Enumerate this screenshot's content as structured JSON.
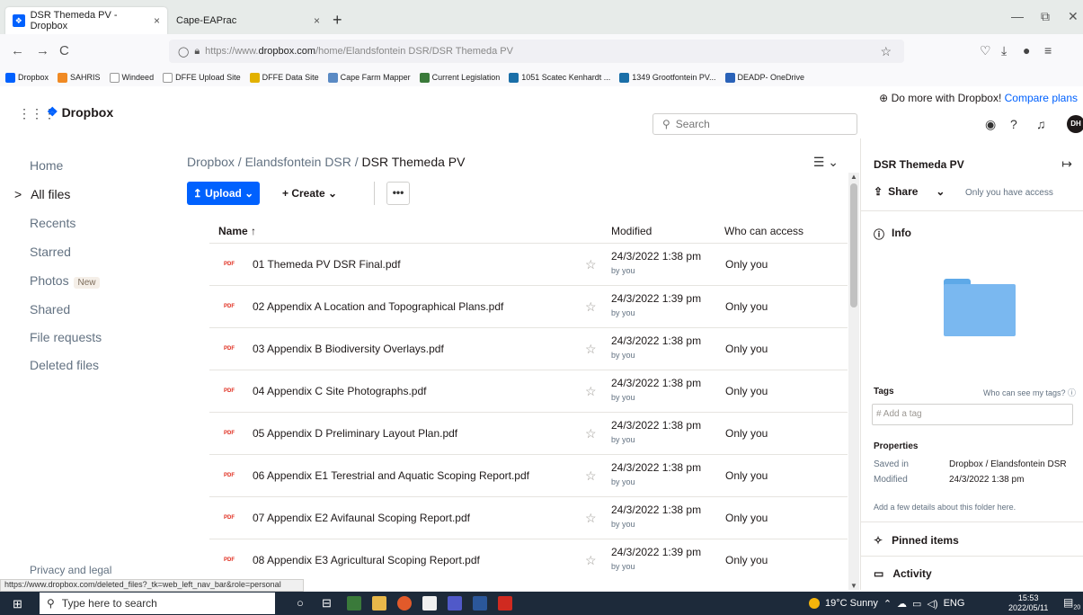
{
  "browser": {
    "tabs": [
      {
        "label": "DSR Themeda PV - Dropbox",
        "close": "×"
      },
      {
        "label": "Cape-EAPrac",
        "close": "×"
      }
    ],
    "new_tab": "+",
    "window_controls": [
      "—",
      "⧉",
      "✕"
    ],
    "nav": {
      "back": "←",
      "forward": "→",
      "reload": "C"
    },
    "url_prefix": "https://www.",
    "url_host": "dropbox.com",
    "url_path": "/home/Elandsfontein DSR/DSR Themeda PV",
    "bookmark_star": "☆",
    "right_icons": [
      "♡",
      "⤓",
      "●",
      "≡"
    ],
    "bookmarks": [
      {
        "label": "Dropbox",
        "color": "#0061fe"
      },
      {
        "label": "SAHRIS",
        "color": "#f08a24"
      },
      {
        "label": "Windeed",
        "color": "#ffffff"
      },
      {
        "label": "DFFE Upload Site",
        "color": "#ffffff"
      },
      {
        "label": "DFFE Data Site",
        "color": "#e2b100"
      },
      {
        "label": "Cape Farm Mapper",
        "color": "#5a8ac4"
      },
      {
        "label": "Current Legislation",
        "color": "#3a7a3a"
      },
      {
        "label": "1051 Scatec Kenhardt ...",
        "color": "#1a6fa8"
      },
      {
        "label": "1349 Grootfontein PV...",
        "color": "#1a6fa8"
      },
      {
        "label": "DEADP- OneDrive",
        "color": "#2a62b8"
      }
    ]
  },
  "header": {
    "grid_icon": "⋮⋮⋮",
    "logo_text": "Dropbox",
    "promo_text": "Do more with Dropbox!",
    "promo_link": "Compare plans",
    "search_placeholder": "Search",
    "avatar": "DH"
  },
  "sidebar": {
    "items": [
      {
        "label": "Home"
      },
      {
        "label": "All files",
        "arrow": ">"
      },
      {
        "label": "Recents"
      },
      {
        "label": "Starred"
      },
      {
        "label": "Photos",
        "badge": "New"
      },
      {
        "label": "Shared"
      },
      {
        "label": "File requests"
      },
      {
        "label": "Deleted files"
      }
    ],
    "privacy": "Privacy and legal"
  },
  "main": {
    "breadcrumb": {
      "path": "Dropbox / Elandsfontein DSR / ",
      "current": "DSR Themeda PV"
    },
    "view_icon": "☰ ⌄",
    "upload_label": "↥ Upload ⌄",
    "create_label": "+ Create ⌄",
    "more_label": "•••",
    "columns": {
      "name": "Name ↑",
      "modified": "Modified",
      "access": "Who can access"
    },
    "files": [
      {
        "icon": "PDF",
        "name": "01 Themeda PV DSR Final.pdf",
        "modified": "24/3/2022 1:38 pm",
        "by": "by you",
        "access": "Only you"
      },
      {
        "icon": "PDF",
        "name": "02 Appendix A Location and Topographical Plans.pdf",
        "modified": "24/3/2022 1:39 pm",
        "by": "by you",
        "access": "Only you"
      },
      {
        "icon": "PDF",
        "name": "03 Appendix B Biodiversity Overlays.pdf",
        "modified": "24/3/2022 1:38 pm",
        "by": "by you",
        "access": "Only you"
      },
      {
        "icon": "PDF",
        "name": "04 Appendix C Site Photographs.pdf",
        "modified": "24/3/2022 1:38 pm",
        "by": "by you",
        "access": "Only you"
      },
      {
        "icon": "PDF",
        "name": "05 Appendix D Preliminary Layout Plan.pdf",
        "modified": "24/3/2022 1:38 pm",
        "by": "by you",
        "access": "Only you"
      },
      {
        "icon": "PDF",
        "name": "06 Appendix E1 Terestrial and Aquatic Scoping Report.pdf",
        "modified": "24/3/2022 1:38 pm",
        "by": "by you",
        "access": "Only you"
      },
      {
        "icon": "PDF",
        "name": "07 Appendix E2 Avifaunal Scoping Report.pdf",
        "modified": "24/3/2022 1:38 pm",
        "by": "by you",
        "access": "Only you"
      },
      {
        "icon": "PDF",
        "name": "08 Appendix E3 Agricultural Scoping Report.pdf",
        "modified": "24/3/2022 1:39 pm",
        "by": "by you",
        "access": "Only you"
      }
    ]
  },
  "panel": {
    "title": "DSR Themeda PV",
    "collapse": "↦",
    "share": "Share",
    "access_text": "Only you have access",
    "info": "Info",
    "tags": "Tags",
    "tags_q": "Who can see my tags? ⓘ",
    "tag_placeholder": "# Add a tag",
    "properties": "Properties",
    "saved_in_k": "Saved in",
    "saved_in_v": "Dropbox / Elandsfontein DSR",
    "modified_k": "Modified",
    "modified_v": "24/3/2022 1:38 pm",
    "add_details": "Add a few details about this folder here.",
    "pinned": "Pinned items",
    "activity": "Activity"
  },
  "status_url": "https://www.dropbox.com/deleted_files?_tk=web_left_nav_bar&role=personal",
  "taskbar": {
    "search_placeholder": "Type here to search",
    "weather": "19°C  Sunny",
    "lang": "ENG",
    "time": "15:53",
    "date": "2022/05/11",
    "notif_count": "20"
  }
}
